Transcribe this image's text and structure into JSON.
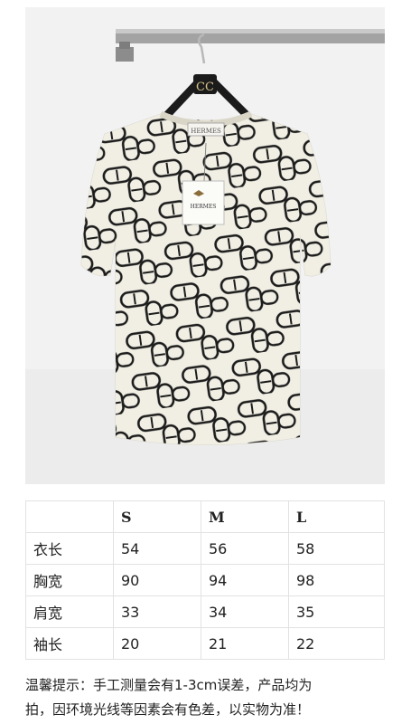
{
  "photo": {
    "hanger_logo": "CC",
    "tag_brand": "HERMES",
    "neck_label_text": "HERMES"
  },
  "size_table": {
    "corner": "",
    "sizes": [
      "S",
      "M",
      "L"
    ],
    "rows": [
      {
        "label": "衣长",
        "values": [
          "54",
          "56",
          "58"
        ]
      },
      {
        "label": "胸宽",
        "values": [
          "90",
          "94",
          "98"
        ]
      },
      {
        "label": "肩宽",
        "values": [
          "33",
          "34",
          "35"
        ]
      },
      {
        "label": "袖长",
        "values": [
          "20",
          "21",
          "22"
        ]
      }
    ]
  },
  "notice": {
    "line1": "温馨提示：手工测量会有1-3cm误差，产品均为",
    "line2": "拍，因环境光线等因素会有色差，以实物为准！"
  },
  "colors": {
    "fabric": "#f1efe4",
    "print": "#1c1c1c",
    "wall": "#f2f2f2",
    "rail": "#9a9a9a"
  }
}
